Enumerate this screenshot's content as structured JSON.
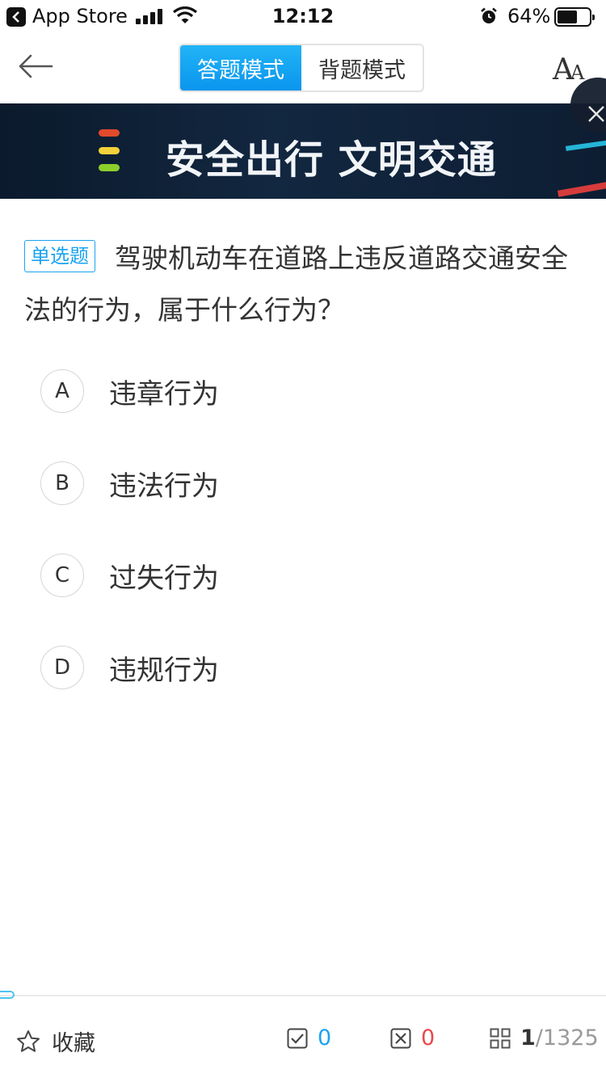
{
  "status_bar": {
    "app": "App Store",
    "time": "12:12",
    "battery": "64%",
    "battery_level": 0.64
  },
  "nav": {
    "back_icon": "arrow-left-icon",
    "modes": [
      "答题模式",
      "背题模式"
    ],
    "active_mode": 0,
    "font_icon": "font-size-icon",
    "font_big": "A",
    "font_small": "A"
  },
  "banner": {
    "text": "安全出行  文明交通",
    "close_icon": "close-icon"
  },
  "question": {
    "type": "单选题",
    "text": "驾驶机动车在道路上违反道路交通安全法的行为，属于什么行为？",
    "options": [
      {
        "letter": "A",
        "text": "违章行为"
      },
      {
        "letter": "B",
        "text": "违法行为"
      },
      {
        "letter": "C",
        "text": "过失行为"
      },
      {
        "letter": "D",
        "text": "违规行为"
      }
    ]
  },
  "bottom": {
    "favorite_label": "收藏",
    "right_count": "0",
    "wrong_count": "0",
    "current": "1",
    "separator": "/",
    "total": "1325"
  },
  "colors": {
    "accent": "#1aa3f0",
    "wrong": "#e84a4a",
    "banner_bg": "#122740"
  }
}
